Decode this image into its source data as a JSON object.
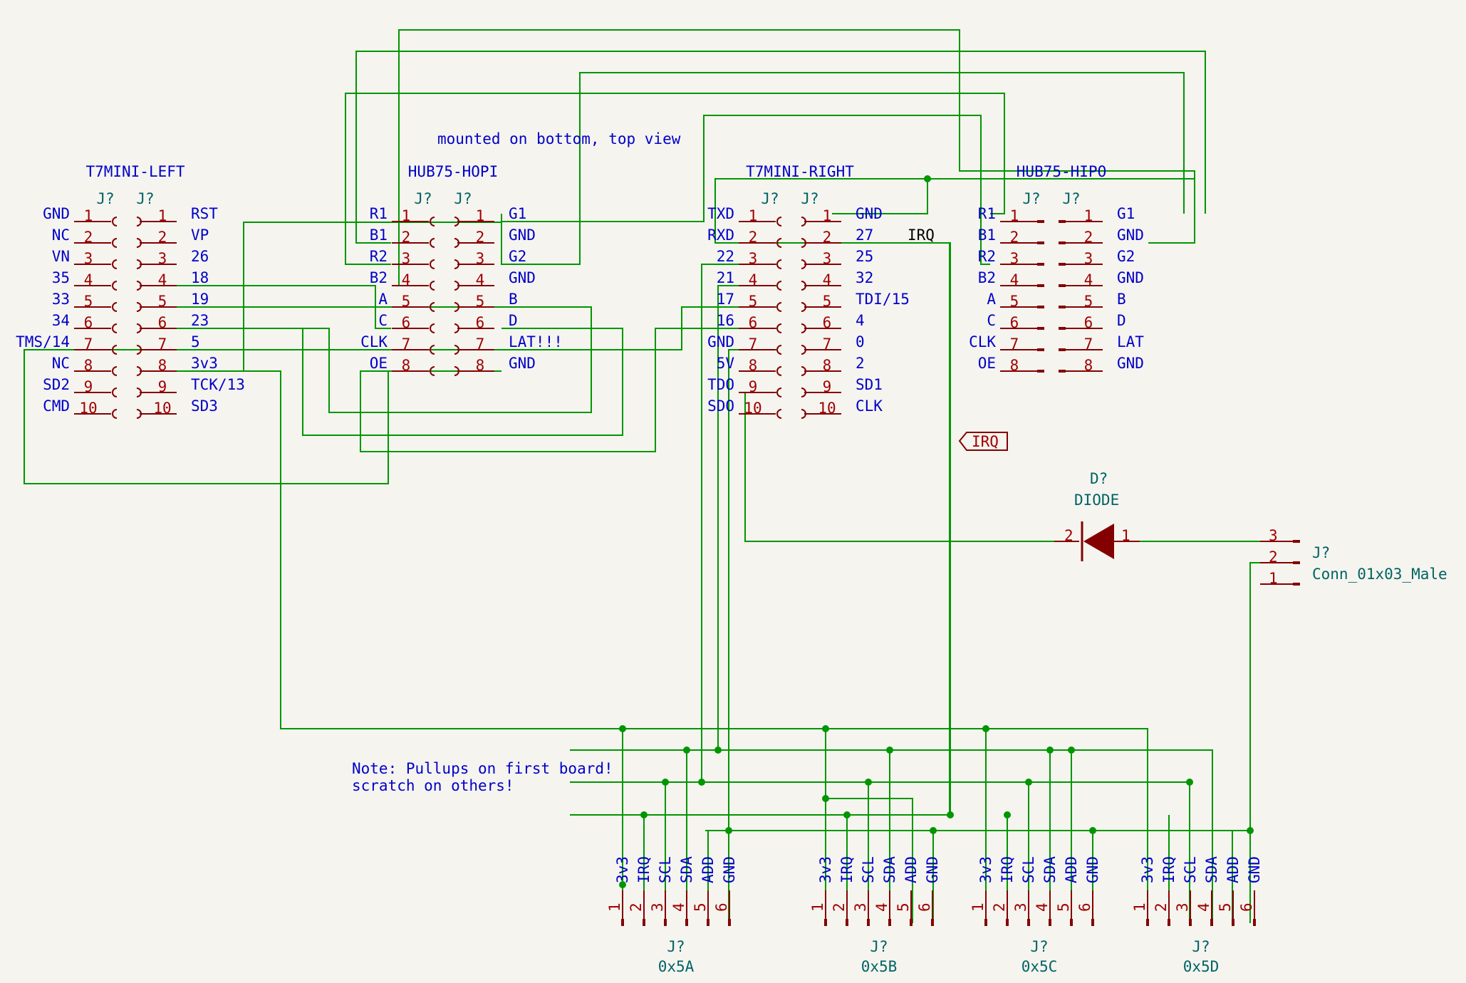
{
  "notes": {
    "mounted": "mounted on bottom, top view",
    "pullups_line1": "Note: Pullups on first board!",
    "pullups_line2": "scratch on others!"
  },
  "headers": [
    {
      "title": "T7MINI-LEFT",
      "ref_a": "J?",
      "ref_b": "J?",
      "left_labels": [
        "GND",
        "NC",
        "VN",
        "35",
        "33",
        "34",
        "TMS/14",
        "NC",
        "SD2",
        "CMD"
      ],
      "right_labels": [
        "RST",
        "VP",
        "26",
        "18",
        "19",
        "23",
        "5",
        "3v3",
        "TCK/13",
        "SD3"
      ],
      "pin_a": [
        "1",
        "2",
        "3",
        "4",
        "5",
        "6",
        "7",
        "8",
        "9",
        "10"
      ],
      "pin_b": [
        "1",
        "2",
        "3",
        "4",
        "5",
        "6",
        "7",
        "8",
        "9",
        "10"
      ]
    },
    {
      "title": "HUB75-HOPI",
      "ref_a": "J?",
      "ref_b": "J?",
      "left_labels": [
        "R1",
        "B1",
        "R2",
        "B2",
        "A",
        "C",
        "CLK",
        "OE"
      ],
      "right_labels": [
        "G1",
        "GND",
        "G2",
        "GND",
        "B",
        "D",
        "LAT!!!",
        "GND"
      ],
      "pin_a": [
        "1",
        "2",
        "3",
        "4",
        "5",
        "6",
        "7",
        "8"
      ],
      "pin_b": [
        "1",
        "2",
        "3",
        "4",
        "5",
        "6",
        "7",
        "8"
      ]
    },
    {
      "title": "T7MINI-RIGHT",
      "ref_a": "J?",
      "ref_b": "J?",
      "left_labels": [
        "TXD",
        "RXD",
        "22",
        "21",
        "17",
        "16",
        "GND",
        "5V",
        "TDO",
        "SDO"
      ],
      "right_labels": [
        "GND",
        "27",
        "25",
        "32",
        "TDI/15",
        "4",
        "0",
        "2",
        "SD1",
        "CLK"
      ],
      "pin_a": [
        "1",
        "2",
        "3",
        "4",
        "5",
        "6",
        "7",
        "8",
        "9",
        "10"
      ],
      "pin_b": [
        "1",
        "2",
        "3",
        "4",
        "5",
        "6",
        "7",
        "8",
        "9",
        "10"
      ]
    },
    {
      "title": "HUB75-HIPO",
      "ref_a": "J?",
      "ref_b": "J?",
      "left_labels": [
        "R1",
        "B1",
        "R2",
        "B2",
        "A",
        "C",
        "CLK",
        "OE"
      ],
      "right_labels": [
        "G1",
        "GND",
        "G2",
        "GND",
        "B",
        "D",
        "LAT",
        "GND"
      ],
      "pin_a": [
        "1",
        "2",
        "3",
        "4",
        "5",
        "6",
        "7",
        "8"
      ],
      "pin_b": [
        "1",
        "2",
        "3",
        "4",
        "5",
        "6",
        "7",
        "8"
      ]
    }
  ],
  "net_labels": {
    "irq_wire": "IRQ",
    "irq_flag": "IRQ"
  },
  "diode": {
    "ref": "D?",
    "value": "DIODE",
    "pin_anode": "2",
    "pin_cathode": "1"
  },
  "conn3": {
    "ref": "J?",
    "value": "Conn_01x03_Male",
    "pins": [
      "3",
      "2",
      "1"
    ]
  },
  "i2c_connectors": {
    "signals": [
      "3v3",
      "IRQ",
      "SCL",
      "SDA",
      "ADD",
      "GND"
    ],
    "pins": [
      "1",
      "2",
      "3",
      "4",
      "5",
      "6"
    ],
    "items": [
      {
        "ref": "J?",
        "value": "0x5A"
      },
      {
        "ref": "J?",
        "value": "0x5B"
      },
      {
        "ref": "J?",
        "value": "0x5C"
      },
      {
        "ref": "J?",
        "value": "0x5D"
      }
    ]
  }
}
